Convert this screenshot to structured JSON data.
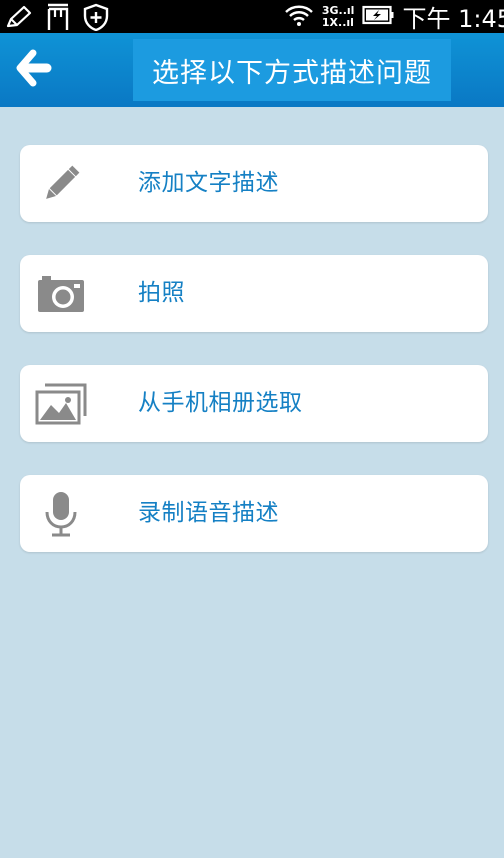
{
  "status_bar": {
    "net_top": "3G..ıl",
    "net_bottom": "1X..ıl",
    "time": "下午 1:45"
  },
  "header": {
    "title": "选择以下方式描述问题"
  },
  "options": [
    {
      "label": "添加文字描述",
      "icon": "pencil-icon"
    },
    {
      "label": "拍照",
      "icon": "camera-icon"
    },
    {
      "label": "从手机相册选取",
      "icon": "gallery-icon"
    },
    {
      "label": "录制语音描述",
      "icon": "microphone-icon"
    }
  ],
  "colors": {
    "header_blue": "#0a85cd",
    "title_box_blue": "#1c9be0",
    "background": "#c6dde9",
    "label_blue": "#1580c4",
    "icon_gray": "#8a8a8a"
  }
}
